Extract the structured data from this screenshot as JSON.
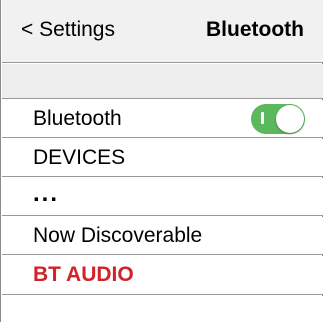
{
  "navbar": {
    "back_label": "< Settings",
    "title": "Bluetooth"
  },
  "rows": {
    "bluetooth": {
      "label": "Bluetooth",
      "toggle_on": true
    },
    "devices": {
      "label": "DEVICES"
    },
    "more": {
      "label": "..."
    },
    "now_discoverable": {
      "label": "Now Discoverable"
    },
    "bt_audio": {
      "label": "BT AUDIO"
    }
  },
  "colors": {
    "toggle_on": "#5cb85c",
    "bt_audio_text": "#d0232a",
    "navbar_bg": "#f1f1f1",
    "spacer_bg": "#eeeeee",
    "separator": "#9a9a9a"
  },
  "icons": {
    "toggle": "toggle-switch-on"
  }
}
